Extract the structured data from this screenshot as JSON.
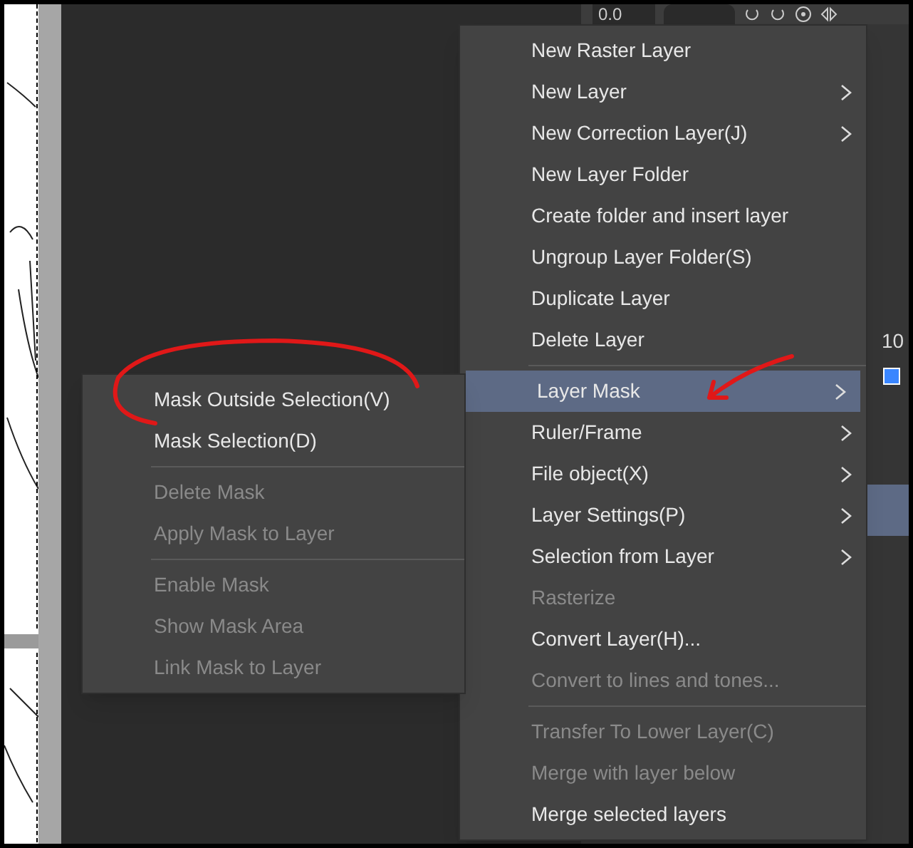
{
  "toolbar": {
    "angle_value": "0.0"
  },
  "layer_panel": {
    "opacity_value": "10"
  },
  "context_menu": {
    "items": [
      {
        "kind": "item",
        "label": "New Raster Layer",
        "submenu": false,
        "disabled": false,
        "selected": false
      },
      {
        "kind": "item",
        "label": "New Layer",
        "submenu": true,
        "disabled": false,
        "selected": false
      },
      {
        "kind": "item",
        "label": "New Correction Layer(J)",
        "submenu": true,
        "disabled": false,
        "selected": false
      },
      {
        "kind": "item",
        "label": "New Layer Folder",
        "submenu": false,
        "disabled": false,
        "selected": false
      },
      {
        "kind": "item",
        "label": "Create folder and insert layer",
        "submenu": false,
        "disabled": false,
        "selected": false
      },
      {
        "kind": "item",
        "label": "Ungroup Layer Folder(S)",
        "submenu": false,
        "disabled": false,
        "selected": false
      },
      {
        "kind": "item",
        "label": "Duplicate Layer",
        "submenu": false,
        "disabled": false,
        "selected": false
      },
      {
        "kind": "item",
        "label": "Delete Layer",
        "submenu": false,
        "disabled": false,
        "selected": false
      },
      {
        "kind": "separator"
      },
      {
        "kind": "item",
        "label": "Layer Mask",
        "submenu": true,
        "disabled": false,
        "selected": true
      },
      {
        "kind": "item",
        "label": "Ruler/Frame",
        "submenu": true,
        "disabled": false,
        "selected": false
      },
      {
        "kind": "item",
        "label": "File object(X)",
        "submenu": true,
        "disabled": false,
        "selected": false
      },
      {
        "kind": "item",
        "label": "Layer Settings(P)",
        "submenu": true,
        "disabled": false,
        "selected": false
      },
      {
        "kind": "item",
        "label": "Selection from Layer",
        "submenu": true,
        "disabled": false,
        "selected": false
      },
      {
        "kind": "item",
        "label": "Rasterize",
        "submenu": false,
        "disabled": true,
        "selected": false
      },
      {
        "kind": "item",
        "label": "Convert Layer(H)...",
        "submenu": false,
        "disabled": false,
        "selected": false
      },
      {
        "kind": "item",
        "label": "Convert to lines and tones...",
        "submenu": false,
        "disabled": true,
        "selected": false
      },
      {
        "kind": "separator"
      },
      {
        "kind": "item",
        "label": "Transfer To Lower Layer(C)",
        "submenu": false,
        "disabled": true,
        "selected": false
      },
      {
        "kind": "item",
        "label": "Merge with layer below",
        "submenu": false,
        "disabled": true,
        "selected": false
      },
      {
        "kind": "item",
        "label": "Merge selected layers",
        "submenu": false,
        "disabled": false,
        "selected": false
      }
    ]
  },
  "submenu": {
    "items": [
      {
        "kind": "item",
        "label": "Mask Outside Selection(V)",
        "disabled": false
      },
      {
        "kind": "item",
        "label": "Mask Selection(D)",
        "disabled": false
      },
      {
        "kind": "separator"
      },
      {
        "kind": "item",
        "label": "Delete Mask",
        "disabled": true
      },
      {
        "kind": "item",
        "label": "Apply Mask to Layer",
        "disabled": true
      },
      {
        "kind": "separator"
      },
      {
        "kind": "item",
        "label": "Enable Mask",
        "disabled": true
      },
      {
        "kind": "item",
        "label": "Show Mask Area",
        "disabled": true
      },
      {
        "kind": "item",
        "label": "Link Mask to Layer",
        "disabled": true
      }
    ]
  }
}
